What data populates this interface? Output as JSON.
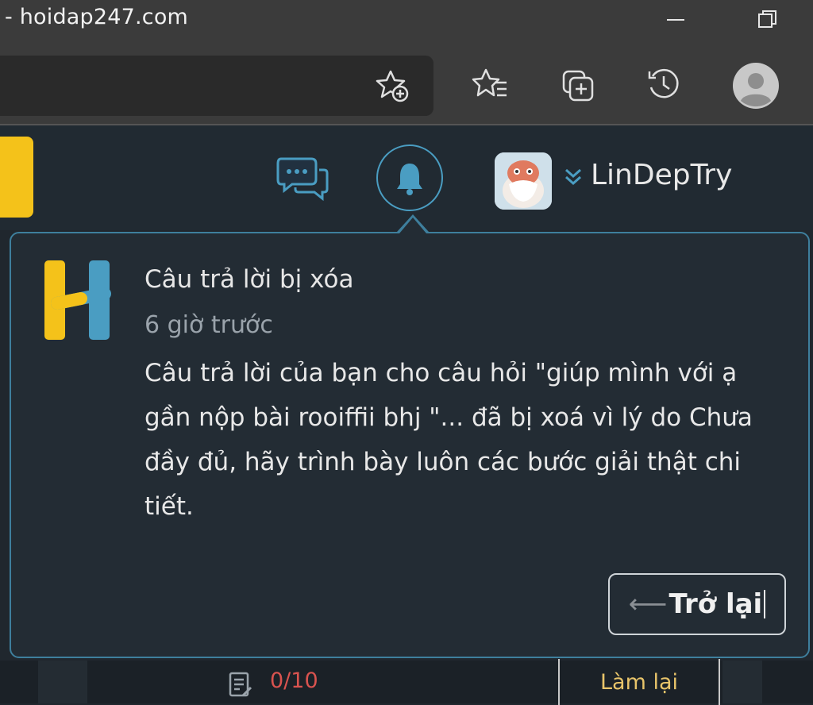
{
  "browser": {
    "title": "- hoidap247.com"
  },
  "header": {
    "username": "LinDepTry"
  },
  "notification": {
    "title": "Câu trả lời bị xóa",
    "time": "6 giờ trước",
    "body": "Câu trả lời của bạn cho câu hỏi \"giúp mình với ạ gần nộp bài rooiffii bhj \"... đã bị xoá vì lý do Chưa đầy đủ, hãy trình bày luôn các bước giải thật chi tiết.",
    "back_arrow": "⟵",
    "back_label": "Trở lại"
  },
  "bottom": {
    "score": "0/10",
    "redo_label": "Làm lại"
  },
  "colors": {
    "accent": "#4a9dc2",
    "brand_yellow": "#f4c21a",
    "score_red": "#d9534f",
    "redo_gold": "#e8c46a"
  },
  "icons": [
    "favorite-add-icon",
    "favorites-icon",
    "collections-icon",
    "history-icon",
    "profile-icon",
    "chat-icon",
    "bell-icon",
    "chevron-down-icon",
    "logo-h-icon",
    "score-sheet-icon"
  ]
}
